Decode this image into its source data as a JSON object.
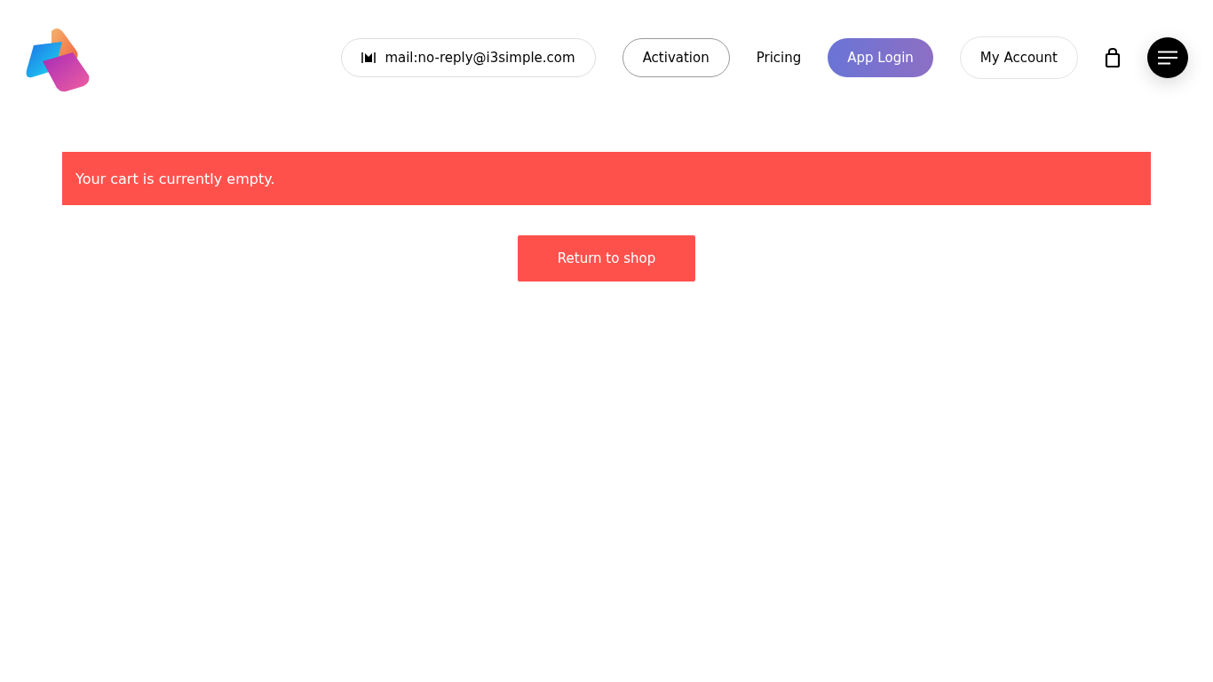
{
  "header": {
    "nav": [
      {
        "label": "mail:no-reply@i3simple.com",
        "kind": "contact"
      },
      {
        "label": "Activation",
        "kind": "outline"
      },
      {
        "label": "Pricing",
        "kind": "plain"
      },
      {
        "label": "App Login",
        "kind": "gradient"
      },
      {
        "label": "My Account",
        "kind": "pill"
      }
    ]
  },
  "notice": {
    "text": "Your cart is currently empty."
  },
  "actions": {
    "button": "Return to shop"
  }
}
